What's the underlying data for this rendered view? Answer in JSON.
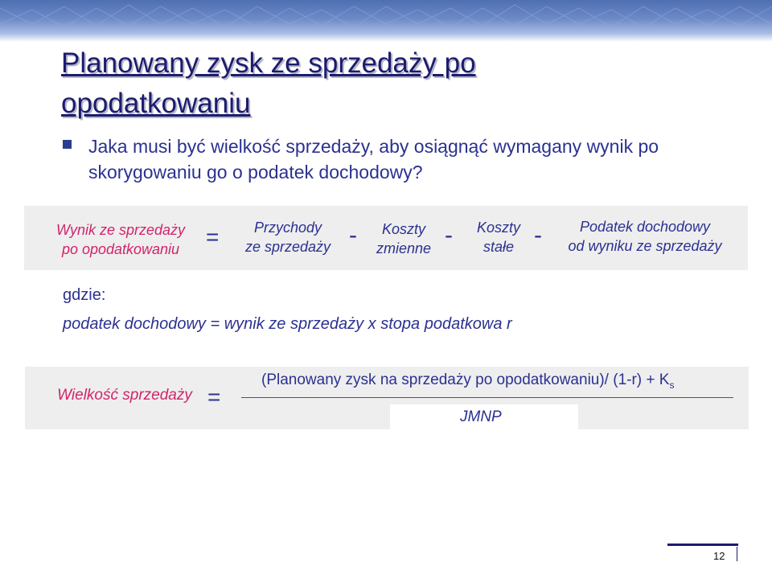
{
  "header": {
    "title": "Planowany zysk ze sprzedaży po opodatkowaniu"
  },
  "bullet": {
    "text": "Jaka musi być wielkość sprzedaży, aby osiągnąć wymagany wynik po skorygowaniu go o podatek dochodowy?"
  },
  "equation1": {
    "lhs_line1": "Wynik ze sprzedaży",
    "lhs_line2": "po opodatkowaniu",
    "equals": "=",
    "term1_line1": "Przychody",
    "term1_line2": "ze sprzedaży",
    "minus": "-",
    "term2_line1": "Koszty",
    "term2_line2": "zmienne",
    "term3_line1": "Koszty",
    "term3_line2": "stałe",
    "term4_line1": "Podatek dochodowy",
    "term4_line2": "od wyniku ze sprzedaży"
  },
  "where": {
    "label": "gdzie:",
    "formula": "podatek dochodowy = wynik ze sprzedaży x stopa podatkowa r"
  },
  "equation2": {
    "lhs": "Wielkość sprzedaży",
    "equals": "=",
    "numerator_main": "(Planowany zysk na sprzedaży po opodatkowaniu)/ (1-r) + K",
    "numerator_sub": "s",
    "denominator": "JMNP"
  },
  "footer": {
    "page_number": "12"
  },
  "colors": {
    "text": "#2b3190",
    "accent_red": "#d2236a",
    "title": "#1b1c6e"
  }
}
